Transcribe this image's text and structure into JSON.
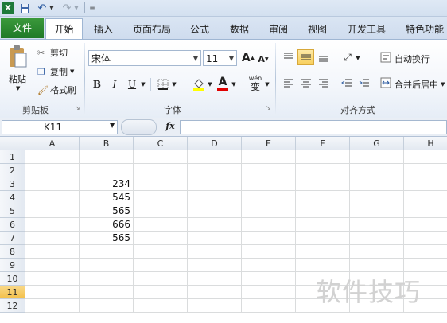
{
  "ribbon_tabs": {
    "file": "文件",
    "home": "开始",
    "insert": "插入",
    "page_layout": "页面布局",
    "formulas": "公式",
    "data": "数据",
    "review": "审阅",
    "view": "视图",
    "developer": "开发工具",
    "special": "特色功能"
  },
  "clipboard": {
    "paste": "粘贴",
    "cut": "剪切",
    "copy": "复制",
    "format_painter": "格式刷",
    "group_label": "剪贴板"
  },
  "font": {
    "name": "宋体",
    "size": "11",
    "group_label": "字体",
    "bold": "B",
    "italic": "I",
    "underline": "U",
    "grow": "A",
    "shrink": "A",
    "color_letter": "A",
    "wen": "wén",
    "wen_char": "变",
    "highlight_color": "#ffff00",
    "font_color": "#e00000"
  },
  "alignment": {
    "wrap_text": "自动换行",
    "merge_center": "合并后居中",
    "group_label": "对齐方式"
  },
  "formula_bar": {
    "name_box": "K11",
    "fx": "fx",
    "content": ""
  },
  "sheet": {
    "columns": [
      "A",
      "B",
      "C",
      "D",
      "E",
      "F",
      "G",
      "H"
    ],
    "rows": [
      "1",
      "2",
      "3",
      "4",
      "5",
      "6",
      "7",
      "8",
      "9",
      "10",
      "11",
      "12"
    ],
    "active_row": "11",
    "b_values": {
      "r3": "234",
      "r4": "545",
      "r5": "565",
      "r6": "666",
      "r7": "565"
    }
  },
  "watermark": "软件技巧",
  "colors": {
    "file_tab": "#1f7a27",
    "active_row_header": "#f3c04a"
  }
}
